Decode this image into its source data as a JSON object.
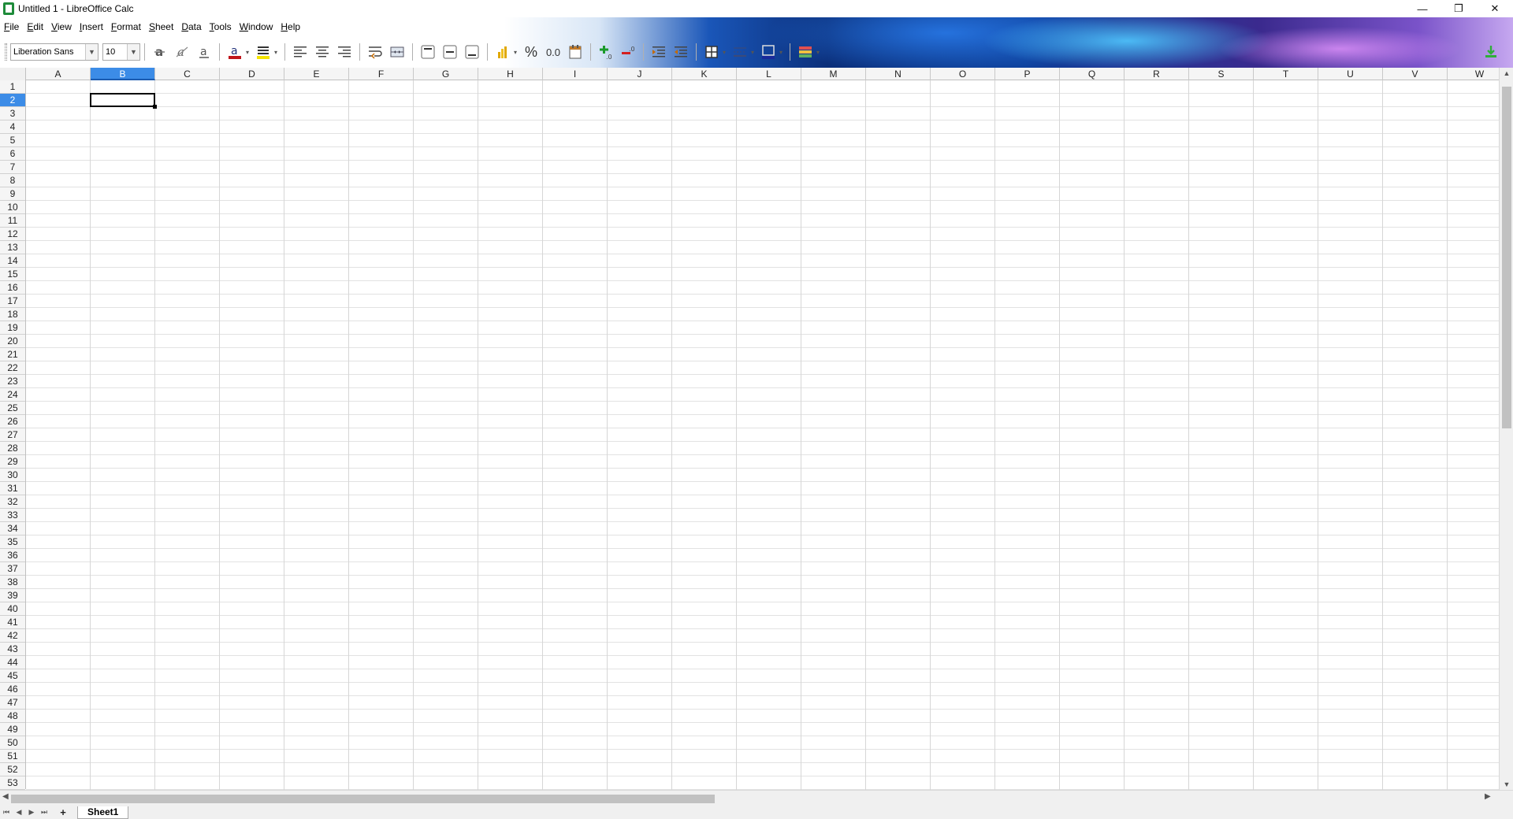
{
  "window": {
    "title": "Untitled 1 - LibreOffice Calc",
    "minimize": "—",
    "restore": "❐",
    "close": "✕"
  },
  "menu": [
    {
      "label": "File",
      "name": "menu-file"
    },
    {
      "label": "Edit",
      "name": "menu-edit"
    },
    {
      "label": "View",
      "name": "menu-view"
    },
    {
      "label": "Insert",
      "name": "menu-insert"
    },
    {
      "label": "Format",
      "name": "menu-format"
    },
    {
      "label": "Sheet",
      "name": "menu-sheet"
    },
    {
      "label": "Data",
      "name": "menu-data"
    },
    {
      "label": "Tools",
      "name": "menu-tools"
    },
    {
      "label": "Window",
      "name": "menu-window"
    },
    {
      "label": "Help",
      "name": "menu-help"
    }
  ],
  "toolbar": {
    "font_name": "Liberation Sans",
    "font_size": "10",
    "percent_label": "%",
    "number_label": "0.0",
    "font_color": "#c0151b",
    "highlight_color": "#f5e400"
  },
  "columns": [
    "A",
    "B",
    "C",
    "D",
    "E",
    "F",
    "G",
    "H",
    "I",
    "J",
    "K",
    "L",
    "M",
    "N",
    "O",
    "P",
    "Q",
    "R",
    "S",
    "T",
    "U",
    "V",
    "W"
  ],
  "selected_column": "B",
  "rows": 53,
  "selected_row": 2,
  "sheet_tabs": [
    "Sheet1"
  ],
  "active_sheet": "Sheet1"
}
